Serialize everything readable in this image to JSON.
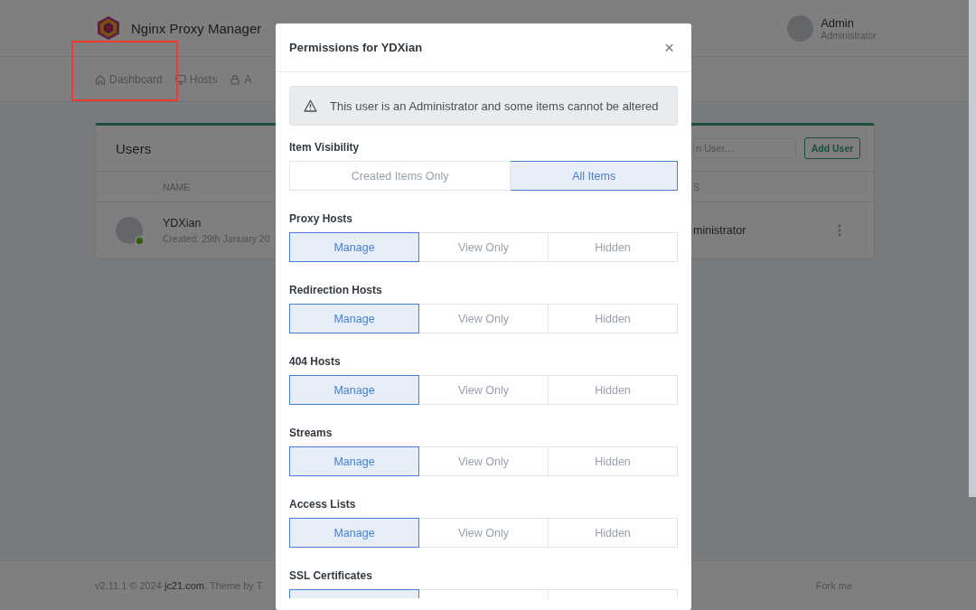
{
  "header": {
    "app_title": "Nginx Proxy Manager",
    "user": {
      "name": "Admin",
      "role": "Administrator"
    }
  },
  "nav": [
    {
      "label": "Dashboard",
      "highlighted": true
    },
    {
      "label": "Hosts",
      "highlighted": false
    },
    {
      "label": "A",
      "highlighted": false
    }
  ],
  "users_card": {
    "title": "Users",
    "search": {
      "placeholder": "n User..."
    },
    "add_button": "Add User",
    "columns": [
      "NAME",
      "S"
    ],
    "rows": [
      {
        "name": "YDXian",
        "created": "Created: 29th January 20",
        "roles": "ministrator",
        "online": true
      }
    ]
  },
  "footer": {
    "left": "v2.11.1 © 2024 ",
    "link": "jc21.com",
    "left_rest": ". Theme by T",
    "right": "Fork me"
  },
  "modal": {
    "title": "Permissions for YDXian",
    "close": "×",
    "alert": "This user is an Administrator and some items cannot be altered",
    "sections": [
      {
        "label": "Item Visibility",
        "options": [
          {
            "label": "Created Items Only",
            "selected": false
          },
          {
            "label": "All Items",
            "selected": true
          }
        ]
      },
      {
        "label": "Proxy Hosts",
        "options": [
          {
            "label": "Manage",
            "selected": true
          },
          {
            "label": "View Only",
            "selected": false
          },
          {
            "label": "Hidden",
            "selected": false
          }
        ]
      },
      {
        "label": "Redirection Hosts",
        "options": [
          {
            "label": "Manage",
            "selected": true
          },
          {
            "label": "View Only",
            "selected": false
          },
          {
            "label": "Hidden",
            "selected": false
          }
        ]
      },
      {
        "label": "404 Hosts",
        "options": [
          {
            "label": "Manage",
            "selected": true
          },
          {
            "label": "View Only",
            "selected": false
          },
          {
            "label": "Hidden",
            "selected": false
          }
        ]
      },
      {
        "label": "Streams",
        "options": [
          {
            "label": "Manage",
            "selected": true
          },
          {
            "label": "View Only",
            "selected": false
          },
          {
            "label": "Hidden",
            "selected": false
          }
        ]
      },
      {
        "label": "Access Lists",
        "options": [
          {
            "label": "Manage",
            "selected": true
          },
          {
            "label": "View Only",
            "selected": false
          },
          {
            "label": "Hidden",
            "selected": false
          }
        ]
      },
      {
        "label": "SSL Certificates",
        "options": [
          {
            "selected": true
          },
          {
            "selected": false
          },
          {
            "selected": false
          }
        ]
      }
    ]
  }
}
